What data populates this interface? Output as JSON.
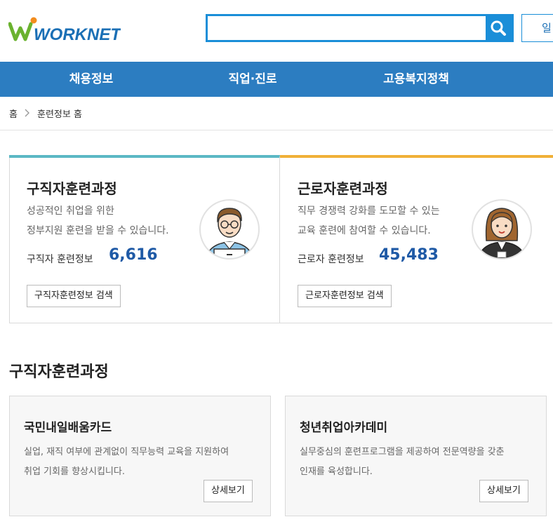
{
  "header": {
    "logo_text": "WORKNET",
    "search": {
      "value": "",
      "placeholder": ""
    },
    "login_label": "일"
  },
  "gnb": {
    "items": [
      "채용정보",
      "직업·진로",
      "고용복지정책"
    ]
  },
  "breadcrumb": {
    "home": "홈",
    "current": "훈련정보 홈"
  },
  "panels": [
    {
      "title": "구직자훈련과정",
      "desc1": "성공적인 취업을 위한",
      "desc2": "정부지원 훈련을 받을 수 있습니다.",
      "count_label": "구직자 훈련정보",
      "count": "6,616",
      "button": "구직자훈련정보 검색"
    },
    {
      "title": "근로자훈련과정",
      "desc1": "직무 경쟁력 강화를 도모할 수 있는",
      "desc2": "교육 훈련에 참여할 수 있습니다.",
      "count_label": "근로자 훈련정보",
      "count": "45,483",
      "button": "근로자훈련정보 검색"
    }
  ],
  "section": {
    "title": "구직자훈련과정",
    "cards": [
      {
        "title": "국민내일배움카드",
        "desc1": "실업, 재직 여부에 관계없이 직무능력 교육을 지원하여",
        "desc2": "취업 기회를 향상시킵니다.",
        "button": "상세보기"
      },
      {
        "title": "청년취업아카데미",
        "desc1": "실무중심의 훈련프로그램을 제공하여 전문역량을 갖춘",
        "desc2": "인재를 육성합니다.",
        "button": "상세보기"
      }
    ]
  },
  "colors": {
    "nav_blue": "#2c7dc1",
    "search_blue": "#1a8ed8",
    "count_blue": "#1f5aa6",
    "teal_accent": "#5bb8c4",
    "gold_accent": "#f0b038",
    "logo_green": "#6ab22e"
  }
}
